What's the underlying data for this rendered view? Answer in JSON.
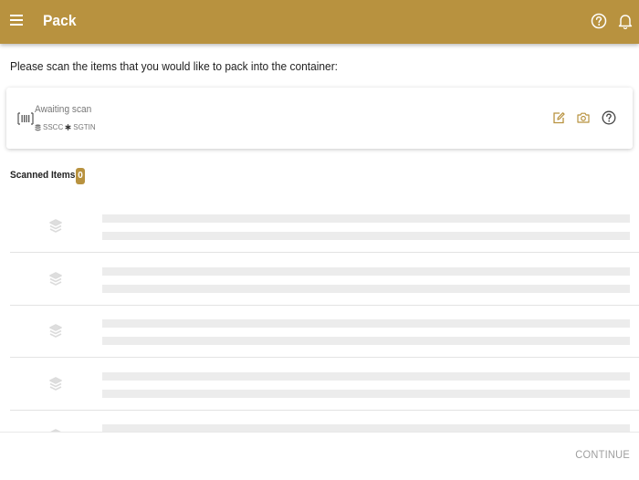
{
  "app": {
    "title": "Pack",
    "menu_icon": "hamburger-menu-icon",
    "help_icon": "help-circle-icon",
    "notification_icon": "bell-icon",
    "accent_color": "#b8923f"
  },
  "instruction": "Please scan the items that you would like to pack into the container:",
  "scan_card": {
    "status": "Awaiting scan",
    "accepted_types": [
      "SSCC",
      "SGTIN"
    ],
    "barcode_icon": "barcode-scan-icon",
    "actions": [
      {
        "name": "manual-entry",
        "icon": "edit-icon"
      },
      {
        "name": "camera-scan",
        "icon": "camera-icon"
      },
      {
        "name": "help",
        "icon": "help-circle-icon"
      }
    ]
  },
  "scanned_items": {
    "label": "Scanned Items",
    "count": "0",
    "placeholder_rows": 5,
    "placeholder_icon": "layers-icon"
  },
  "footer": {
    "continue_label": "CONTINUE"
  }
}
